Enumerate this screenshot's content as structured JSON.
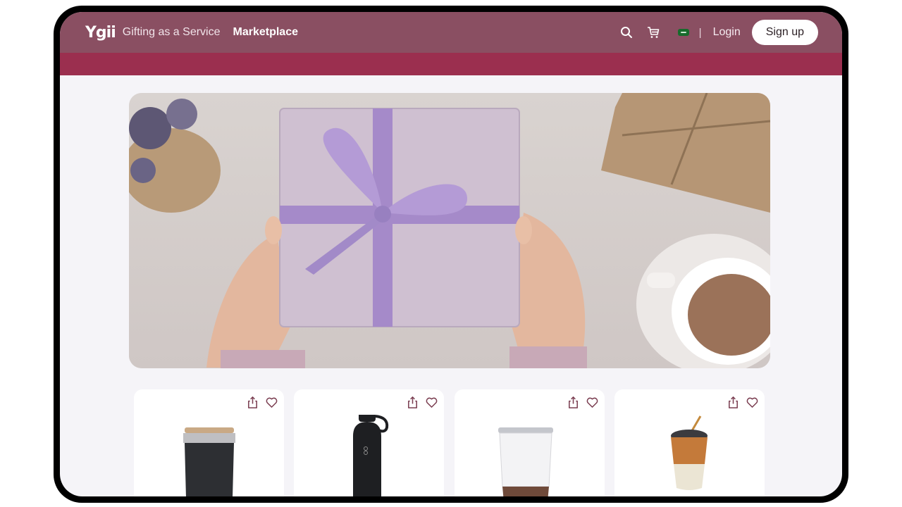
{
  "header": {
    "logo": "Ygii",
    "tagline": "Gifting as a Service",
    "nav_marketplace": "Marketplace",
    "separator": "|",
    "login": "Login",
    "signup": "Sign up",
    "icons": [
      "search-icon",
      "cart-icon",
      "country-flag-icon"
    ],
    "colors": {
      "header_bg": "#8a4f62",
      "accent_bar": "#9b2f4f"
    }
  },
  "hero": {
    "image": "gift-box-hero-image"
  },
  "products": [
    {
      "image": "tumbler-cup-black"
    },
    {
      "image": "water-bottle-black"
    },
    {
      "image": "tumbler-white-cork"
    },
    {
      "image": "glass-cup-leather-sleeve"
    }
  ]
}
